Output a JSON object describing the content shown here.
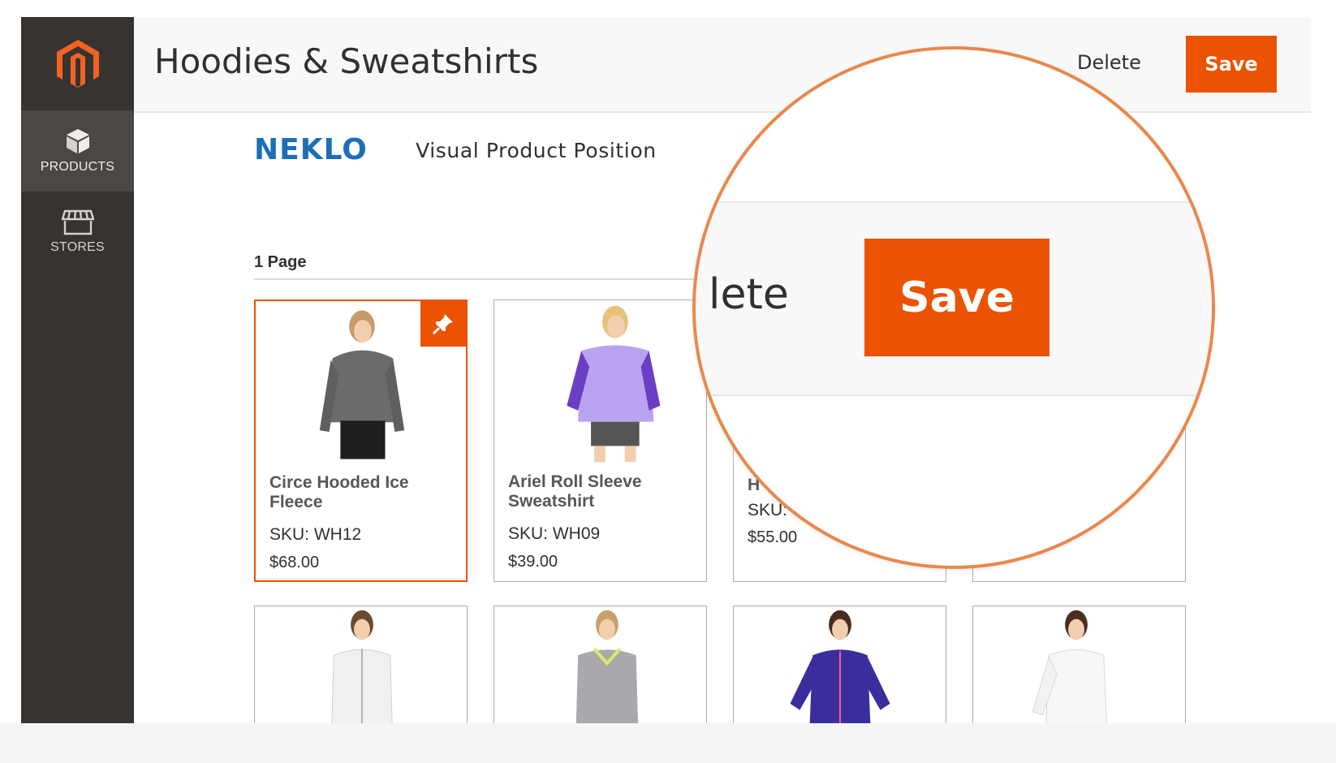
{
  "sidebar": {
    "logo": "magento-logo",
    "items": [
      {
        "label": "PRODUCTS",
        "icon": "box-icon",
        "active": true
      },
      {
        "label": "STORES",
        "icon": "storefront-icon",
        "active": false
      }
    ]
  },
  "header": {
    "title": "Hoodies & Sweatshirts",
    "delete_label": "Delete",
    "save_label": "Save"
  },
  "module": {
    "brand": "NEKLO",
    "title": "Visual Product Position"
  },
  "page_heading": "1 Page",
  "products": [
    {
      "name": "Circe Hooded Ice Fleece",
      "sku": "SKU: WH12",
      "price": "$68.00",
      "pinned": true
    },
    {
      "name": "Ariel Roll Sleeve Sweatshirt",
      "sku": "SKU: WH09",
      "price": "$39.00",
      "pinned": false
    },
    {
      "name": "H",
      "sku": "SKU:",
      "price": "$55.00",
      "pinned": false
    },
    {
      "name": "",
      "sku": "",
      "price": "",
      "pinned": false
    }
  ],
  "magnifier": {
    "delete_fragment": "lete",
    "save_label": "Save"
  },
  "colors": {
    "accent": "#eb5202",
    "sidebar": "#373330",
    "brand_blue": "#1c6fb6",
    "magnifier_ring": "#e8884c"
  }
}
